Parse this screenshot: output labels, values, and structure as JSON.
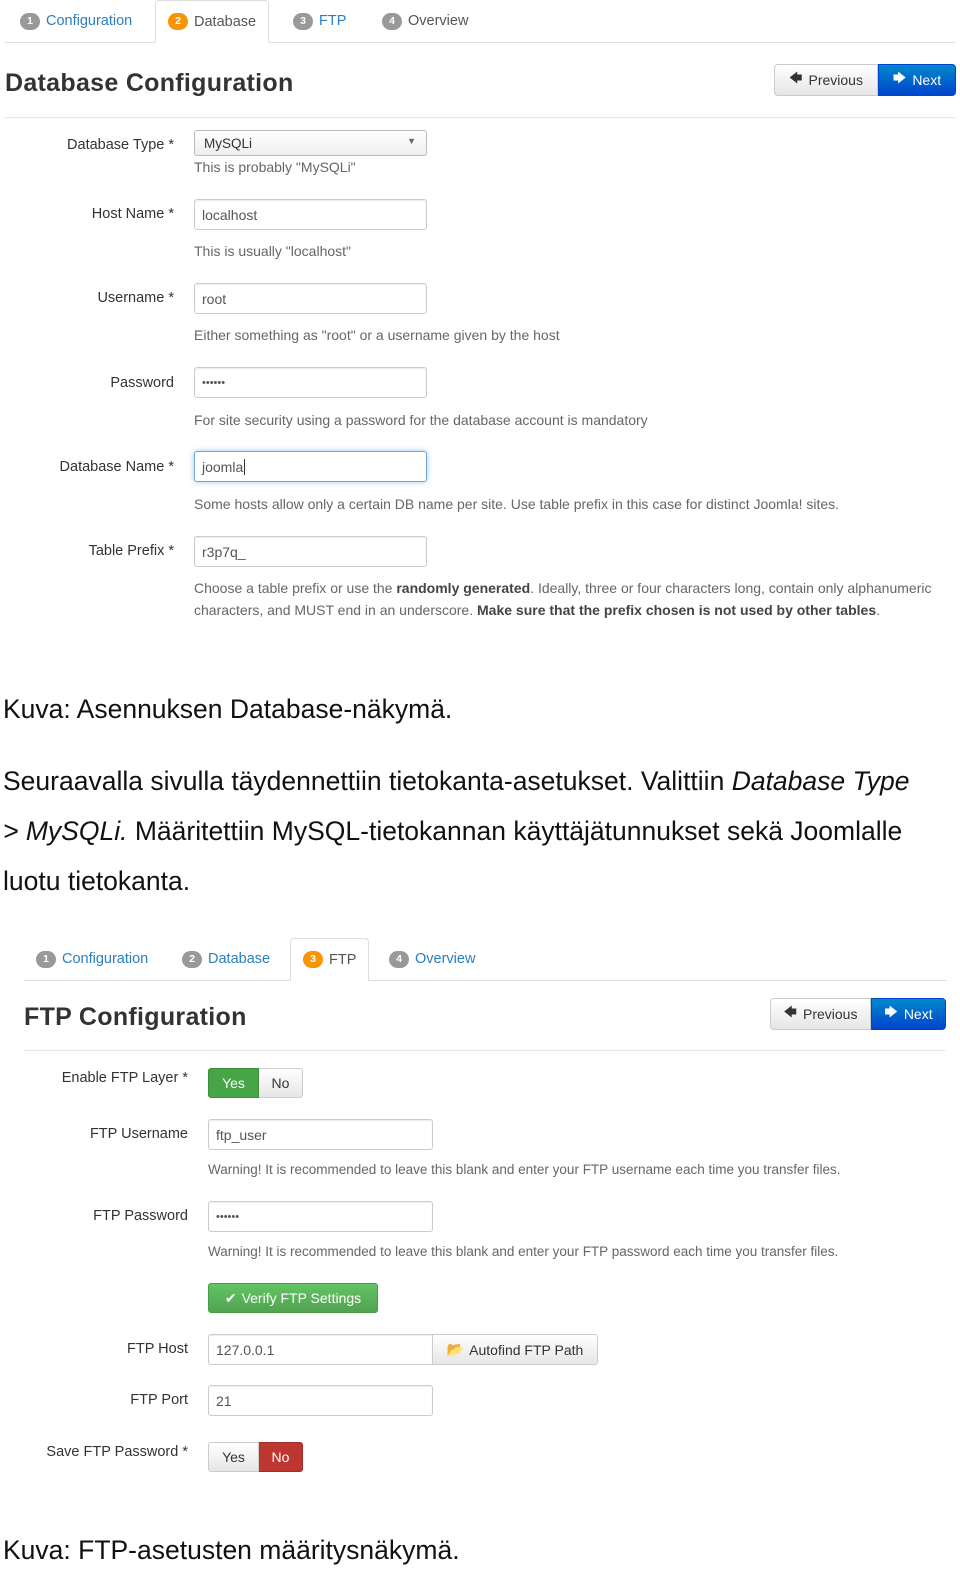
{
  "db": {
    "tabs": [
      {
        "num": "1",
        "label": "Configuration"
      },
      {
        "num": "2",
        "label": "Database"
      },
      {
        "num": "3",
        "label": "FTP"
      },
      {
        "num": "4",
        "label": "Overview"
      }
    ],
    "title": "Database Configuration",
    "prev_label": "Previous",
    "next_label": "Next",
    "fields": {
      "db_type": {
        "label": "Database Type *",
        "value": "MySQLi",
        "help": "This is probably \"MySQLi\""
      },
      "host": {
        "label": "Host Name *",
        "value": "localhost",
        "help": "This is usually \"localhost\""
      },
      "username": {
        "label": "Username *",
        "value": "root",
        "help": "Either something as \"root\" or a username given by the host"
      },
      "password": {
        "label": "Password",
        "value": "••••••",
        "help": "For site security using a password for the database account is mandatory"
      },
      "db_name": {
        "label": "Database Name *",
        "value": "joomla",
        "help": "Some hosts allow only a certain DB name per site. Use table prefix in this case for distinct Joomla! sites."
      },
      "prefix": {
        "label": "Table Prefix *",
        "value": "r3p7q_",
        "help_1": "Choose a table prefix or use the ",
        "help_bold_1": "randomly generated",
        "help_2": ". Ideally, three or four characters long, contain only alphanumeric characters, and MUST end in an underscore. ",
        "help_bold_2": "Make sure that the prefix chosen is not used by other tables",
        "help_3": "."
      }
    }
  },
  "caption_1": "Kuva: Asennuksen Database-näkymä.",
  "paragraph": {
    "line1_a": "Seuraavalla sivulla täydennettiin tietokanta-asetukset. Valittiin ",
    "line1_em": "Database Type",
    "line2_em": "> MySQLi.",
    "line2_b": " Määritettiin MySQL-tietokannan käyttäjätunnukset sekä Joomlalle",
    "line3": "luotu tietokanta."
  },
  "ftp": {
    "tabs": [
      {
        "num": "1",
        "label": "Configuration"
      },
      {
        "num": "2",
        "label": "Database"
      },
      {
        "num": "3",
        "label": "FTP"
      },
      {
        "num": "4",
        "label": "Overview"
      }
    ],
    "title": "FTP Configuration",
    "prev_label": "Previous",
    "next_label": "Next",
    "fields": {
      "enable": {
        "label": "Enable FTP Layer *",
        "yes": "Yes",
        "no": "No",
        "selected": "Yes"
      },
      "username": {
        "label": "FTP Username",
        "value": "ftp_user",
        "help": "Warning! It is recommended to leave this blank and enter your FTP username each time you transfer files."
      },
      "password": {
        "label": "FTP Password",
        "value": "••••••",
        "help": "Warning! It is recommended to leave this blank and enter your FTP password each time you transfer files."
      },
      "verify_label": "Verify FTP Settings",
      "host": {
        "label": "FTP Host",
        "value": "127.0.0.1",
        "autofind_label": "Autofind FTP Path"
      },
      "port": {
        "label": "FTP Port",
        "value": "21"
      },
      "save_pw": {
        "label": "Save FTP Password *",
        "yes": "Yes",
        "no": "No",
        "selected": "No"
      }
    }
  },
  "caption_2": "Kuva: FTP-asetusten määritysnäkymä.",
  "colors": {
    "link": "#2a7fc1",
    "primary": "#0055cc",
    "success": "#46a546",
    "danger": "#bd362f",
    "badge_active": "#f89406"
  }
}
